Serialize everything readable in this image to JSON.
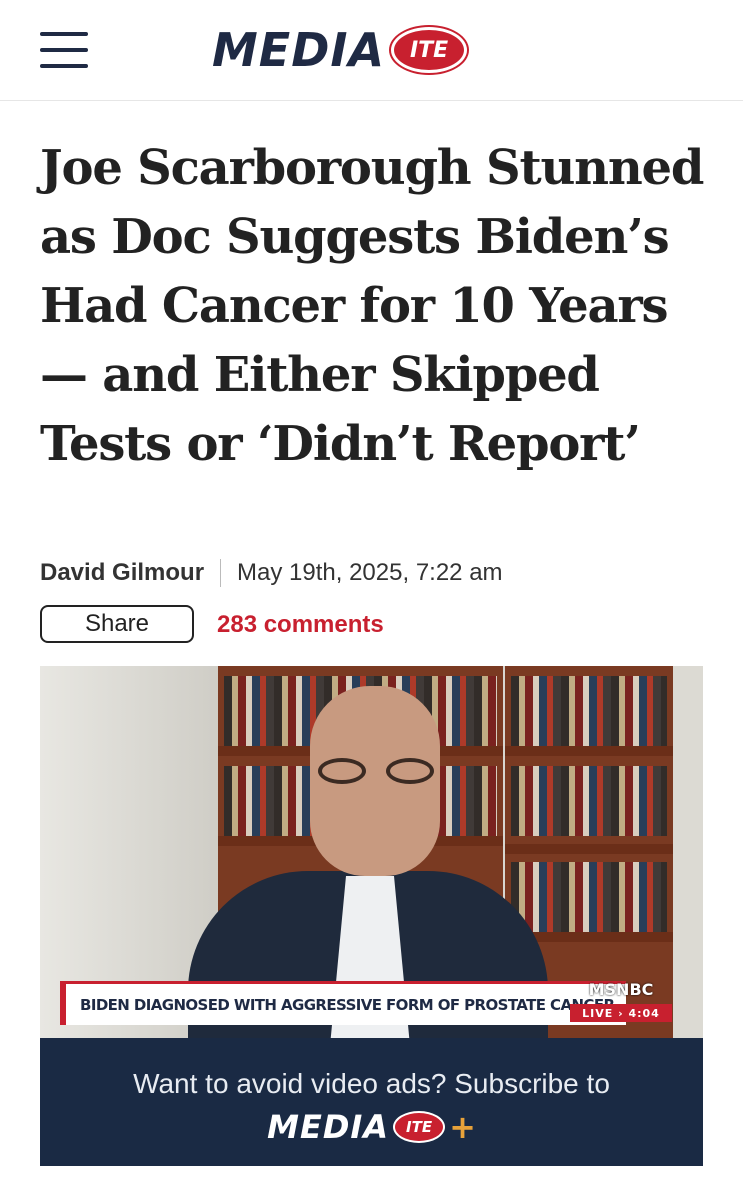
{
  "header": {
    "logo_text": "MEDIA",
    "logo_badge": "ITE"
  },
  "article": {
    "headline": "Joe Scarborough Stunned as Doc Suggests Biden’s Had Cancer for 10 Years — and Either Skipped Tests or ‘Didn’t Report’",
    "author": "David Gilmour",
    "date": "May 19th, 2025, 7:22 am",
    "share_label": "Share",
    "comments_label": "283 comments"
  },
  "video": {
    "chyron": "BIDEN DIAGNOSED WITH AGGRESSIVE FORM OF PROSTATE CANCER",
    "network": "MSNBC",
    "live_label": "LIVE › 4:04",
    "promo_text": "Want to avoid video ads? Subscribe to",
    "promo_logo_text": "MEDIA",
    "promo_logo_badge": "ITE",
    "promo_plus": "+"
  },
  "colors": {
    "brand_navy": "#1f2a44",
    "brand_red": "#c8202f",
    "promo_bg": "#1a2a44",
    "plus_accent": "#e8a23a"
  }
}
